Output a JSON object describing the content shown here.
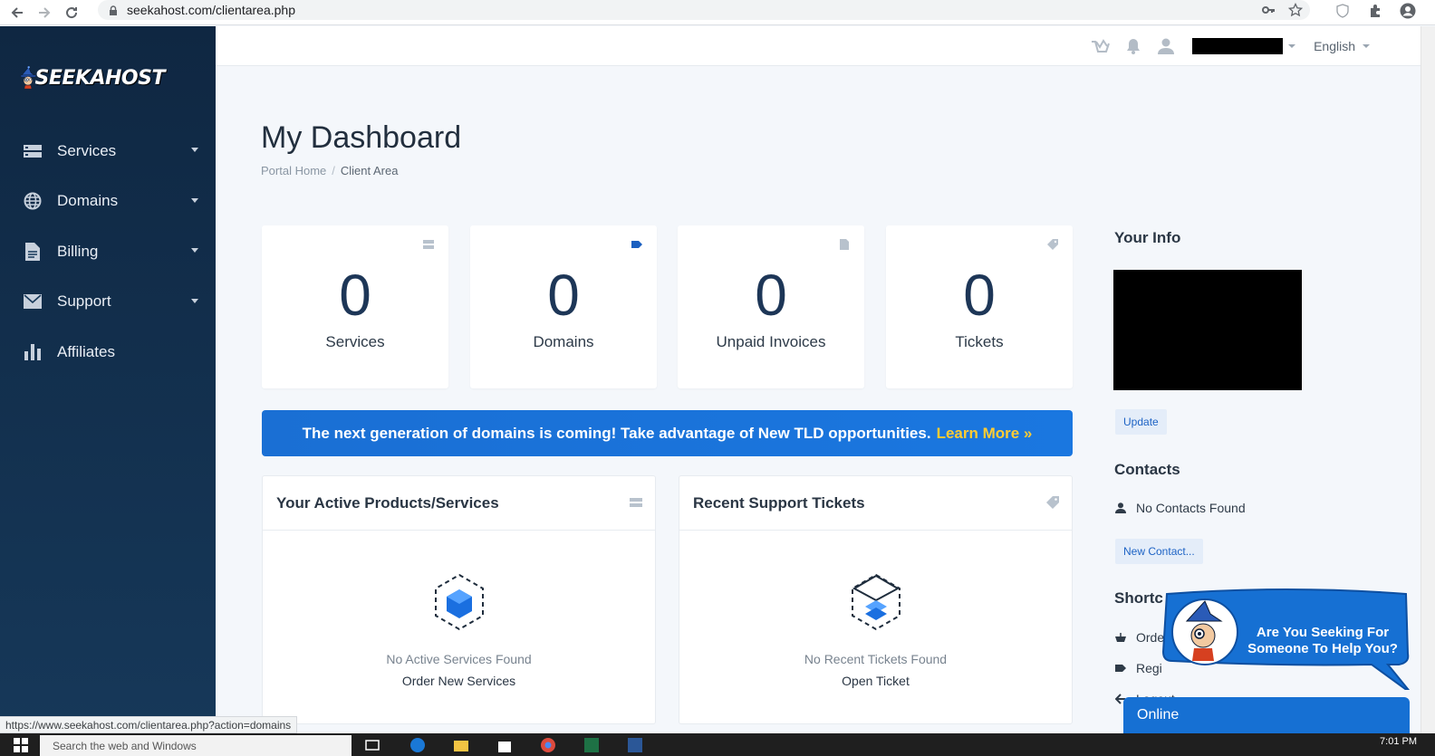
{
  "browser": {
    "url": "seekahost.com/clientarea.php",
    "status_url": "https://www.seekahost.com/clientarea.php?action=domains"
  },
  "sidebar": {
    "logo_text": "SEEKAHOST",
    "items": [
      {
        "label": "Services",
        "icon": "server-icon",
        "has_caret": true
      },
      {
        "label": "Domains",
        "icon": "globe-icon",
        "has_caret": true
      },
      {
        "label": "Billing",
        "icon": "document-icon",
        "has_caret": true
      },
      {
        "label": "Support",
        "icon": "envelope-icon",
        "has_caret": true
      },
      {
        "label": "Affiliates",
        "icon": "bar-chart-icon",
        "has_caret": false
      }
    ]
  },
  "topbar": {
    "language": "English"
  },
  "page": {
    "title": "My Dashboard",
    "breadcrumb": [
      "Portal Home",
      "Client Area"
    ]
  },
  "stats": [
    {
      "value": "0",
      "label": "Services",
      "icon": "server-icon"
    },
    {
      "value": "0",
      "label": "Domains",
      "icon": "tag-icon"
    },
    {
      "value": "0",
      "label": "Unpaid Invoices",
      "icon": "document-icon"
    },
    {
      "value": "0",
      "label": "Tickets",
      "icon": "ticket-icon"
    }
  ],
  "promo": {
    "text": "The next generation of domains is coming! Take advantage of New TLD opportunities.",
    "link": "Learn More »"
  },
  "panels": {
    "services": {
      "title": "Your Active Products/Services",
      "empty": "No Active Services Found",
      "link": "Order New Services"
    },
    "tickets": {
      "title": "Recent Support Tickets",
      "empty": "No Recent Tickets Found",
      "link": "Open Ticket"
    }
  },
  "right": {
    "info_title": "Your Info",
    "update_label": "Update",
    "contacts_title": "Contacts",
    "no_contacts": "No Contacts Found",
    "new_contact": "New Contact...",
    "shortcuts_title": "Shortc",
    "shortcuts": [
      "Orde",
      "Regi",
      "Logout"
    ]
  },
  "chat": {
    "bubble_line1": "Are You Seeking For",
    "bubble_line2": "Someone To Help You?",
    "online": "Online"
  },
  "taskbar": {
    "search_placeholder": "Search the web and Windows",
    "time": "7:01 PM"
  },
  "colors": {
    "sidebar": "#0f2742",
    "accent": "#1a6fd4",
    "promo_link": "#ffcc33",
    "stat_number": "#1d3657"
  }
}
